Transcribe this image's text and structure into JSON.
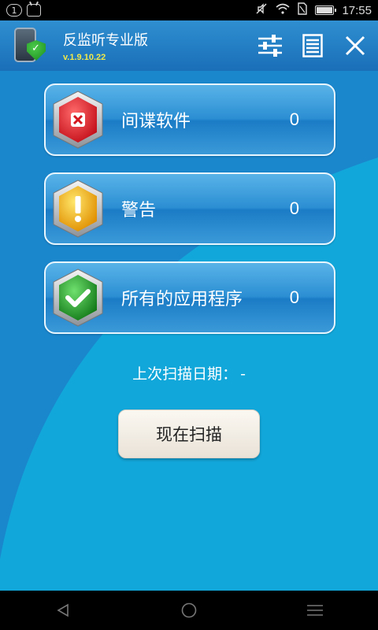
{
  "status_bar": {
    "notification_count": "1",
    "time": "17:55",
    "icons": [
      "notification-count-icon",
      "android-icon",
      "mute-icon",
      "wifi-icon",
      "sim-icon",
      "battery-icon"
    ],
    "battery_level": 0.9
  },
  "app_bar": {
    "title": "反监听专业版",
    "version": "v.1.9.10.22",
    "logo_icon": "phone-shield-icon",
    "actions": [
      "settings-sliders-icon",
      "log-list-icon",
      "close-icon"
    ]
  },
  "colors": {
    "header": "#1a6fb8",
    "background": "#16a9d9",
    "danger": "#e0262e",
    "warning": "#f2b400",
    "safe": "#1f9a22",
    "version": "#f0e84a"
  },
  "categories": [
    {
      "label": "间谍软件",
      "count": "0",
      "icon": "spyware-x-shield-icon"
    },
    {
      "label": "警告",
      "count": "0",
      "icon": "warning-exclaim-shield-icon"
    },
    {
      "label": "所有的应用程序",
      "count": "0",
      "icon": "safe-check-shield-icon"
    }
  ],
  "last_scan": {
    "label": "上次扫描日期：",
    "value": "-"
  },
  "scan_button": {
    "label": "现在扫描"
  },
  "nav_bar": {
    "buttons": [
      "back-icon",
      "home-icon",
      "menu-icon"
    ]
  }
}
